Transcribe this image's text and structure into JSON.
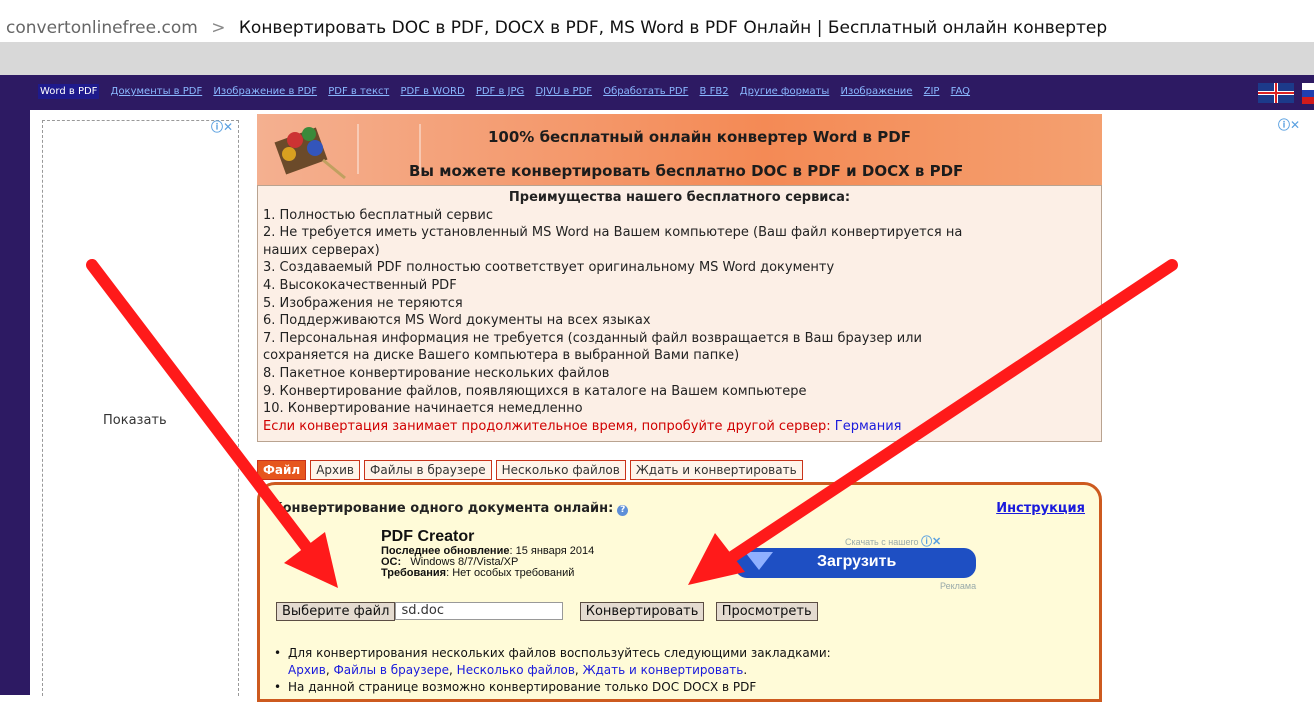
{
  "breadcrumb": {
    "domain": "convertonlinefree.com",
    "separator": ">",
    "page_title": "Конвертировать DOC в PDF, DOCX в PDF, MS Word в PDF Онлайн | Бесплатный онлайн конвертер"
  },
  "nav": {
    "items": [
      {
        "label": "Word в PDF",
        "active": true
      },
      {
        "label": "Документы в PDF"
      },
      {
        "label": "Изображение в PDF"
      },
      {
        "label": "PDF в текст"
      },
      {
        "label": "PDF в WORD"
      },
      {
        "label": "PDF в JPG"
      },
      {
        "label": "DJVU в PDF"
      },
      {
        "label": "Обработать PDF"
      },
      {
        "label": "В FB2"
      },
      {
        "label": "Другие форматы"
      },
      {
        "label": "Изображение"
      },
      {
        "label": "ZIP"
      },
      {
        "label": "FAQ"
      }
    ],
    "flags": [
      "flag-uk-icon",
      "flag-ru-icon"
    ]
  },
  "left_ad": {
    "show_label": "Показать",
    "icons": "ⓘ✕"
  },
  "right_ad": {
    "icons": "ⓘ✕"
  },
  "banner": {
    "line1": "100% бесплатный онлайн конвертер Word в PDF",
    "line2": "Вы можете конвертировать бесплатно DOC в PDF и DOCX в PDF"
  },
  "advantages": {
    "heading": "Преимущества нашего бесплатного сервиса:",
    "items": [
      "1. Полностью бесплатный сервис",
      "2. Не требуется иметь установленный MS Word на Вашем компьютере (Ваш файл конвертируется на",
      "наших серверах)",
      "3. Создаваемый PDF полностью соответствует оригинальному MS Word документу",
      "4. Высококачественный PDF",
      "5. Изображения не теряются",
      "6. Поддерживаются MS Word документы на всех языках",
      "7. Персональная информация не требуется (созданный файл возвращается в Ваш браузер или",
      "сохраняется на диске Вашего компьютера в выбранной Вами папке)",
      "8. Пакетное конвертирование нескольких файлов",
      "9. Конвертирование файлов, появляющихся в каталоге на Вашем компьютере",
      "10. Конвертирование начинается немедленно"
    ],
    "warning": "Если конвертация занимает продолжительное время, попробуйте другой сервер:",
    "server_link": "Германия"
  },
  "tabs": [
    {
      "label": "Файл",
      "active": true
    },
    {
      "label": "Архив"
    },
    {
      "label": "Файлы в браузере"
    },
    {
      "label": "Несколько файлов"
    },
    {
      "label": "Ждать и конвертировать"
    }
  ],
  "panel": {
    "title": "Конвертирование одного документа онлайн:",
    "instruction_link": "Инструкция",
    "pdf_creator": {
      "name": "PDF Creator",
      "updated_label": "Последнее обновление",
      "updated_value": ": 15 января 2014",
      "os_label": "ОС:",
      "os_value": "Windows 8/7/Vista/XP",
      "req_label": "Требования",
      "req_value": ": Нет особых требований"
    },
    "download": {
      "top_label": "Скачать с нашего",
      "button": "Загрузить",
      "ad_label": "Реклама"
    },
    "choose_file": "Выберите файл",
    "file_name": "sd.doc",
    "convert": "Конвертировать",
    "view": "Просмотреть",
    "note1": "Для конвертирования нескольких файлов воспользуйтесь следующими закладками:",
    "note1_links": [
      "Архив",
      "Файлы в браузере",
      "Несколько файлов",
      "Ждать и конвертировать"
    ],
    "note2": "На данной странице возможно конвертирование только DOC DOCX в PDF"
  },
  "colors": {
    "nav_bg": "#2d1a63",
    "accent_orange": "#cd5a1f",
    "panel_bg": "#fffbd8",
    "link": "#1a1adc",
    "warning": "#d00000",
    "arrow": "#ff1a1a"
  }
}
